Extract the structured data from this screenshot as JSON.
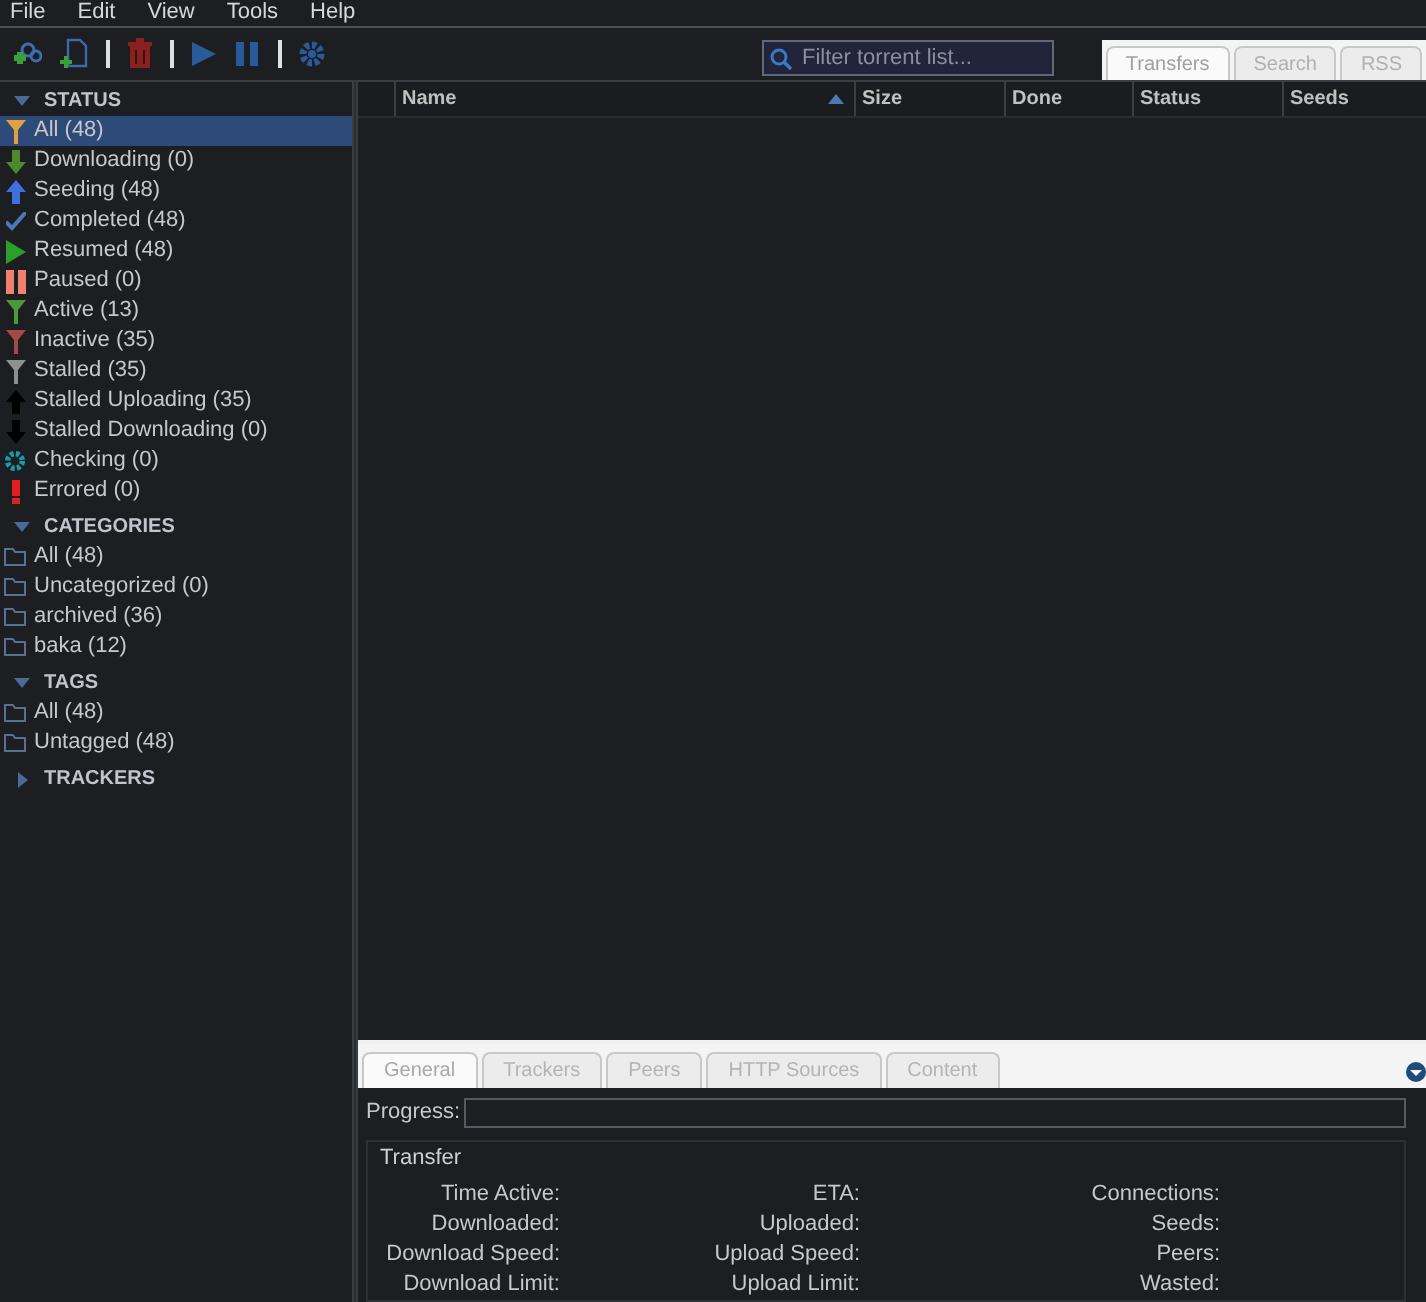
{
  "menu": [
    "File",
    "Edit",
    "View",
    "Tools",
    "Help"
  ],
  "search": {
    "placeholder": "Filter torrent list..."
  },
  "view_tabs": [
    {
      "label": "Transfers",
      "selected": true
    },
    {
      "label": "Search",
      "selected": false
    },
    {
      "label": "RSS",
      "selected": false
    }
  ],
  "sidebar": {
    "sections": [
      {
        "title": "STATUS",
        "expanded": true,
        "items": [
          {
            "label": "All (48)",
            "selected": true
          },
          {
            "label": "Downloading (0)",
            "selected": false
          },
          {
            "label": "Seeding (48)",
            "selected": false
          },
          {
            "label": "Completed (48)",
            "selected": false
          },
          {
            "label": "Resumed (48)",
            "selected": false
          },
          {
            "label": "Paused (0)",
            "selected": false
          },
          {
            "label": "Active (13)",
            "selected": false
          },
          {
            "label": "Inactive (35)",
            "selected": false
          },
          {
            "label": "Stalled (35)",
            "selected": false
          },
          {
            "label": "Stalled Uploading (35)",
            "selected": false
          },
          {
            "label": "Stalled Downloading (0)",
            "selected": false
          },
          {
            "label": "Checking (0)",
            "selected": false
          },
          {
            "label": "Errored (0)",
            "selected": false
          }
        ]
      },
      {
        "title": "CATEGORIES",
        "expanded": true,
        "items": [
          {
            "label": "All (48)",
            "selected": false
          },
          {
            "label": "Uncategorized (0)",
            "selected": false
          },
          {
            "label": "archived (36)",
            "selected": false
          },
          {
            "label": "baka (12)",
            "selected": false
          }
        ]
      },
      {
        "title": "TAGS",
        "expanded": true,
        "items": [
          {
            "label": "All (48)",
            "selected": false
          },
          {
            "label": "Untagged (48)",
            "selected": false
          }
        ]
      },
      {
        "title": "TRACKERS",
        "expanded": false
      }
    ]
  },
  "table": {
    "columns": [
      {
        "label": "Name",
        "sorted": true
      },
      {
        "label": "Size",
        "sorted": false
      },
      {
        "label": "Done",
        "sorted": false
      },
      {
        "label": "Status",
        "sorted": false
      },
      {
        "label": "Seeds",
        "sorted": false
      }
    ]
  },
  "detail_tabs": [
    {
      "label": "General",
      "selected": true
    },
    {
      "label": "Trackers",
      "selected": false
    },
    {
      "label": "Peers",
      "selected": false
    },
    {
      "label": "HTTP Sources",
      "selected": false
    },
    {
      "label": "Content",
      "selected": false
    }
  ],
  "progress_label": "Progress:",
  "progress": {
    "level": 0
  },
  "transfer": {
    "title": "Transfer",
    "rows": [
      [
        "Time Active:",
        "ETA:",
        "Connections:"
      ],
      [
        "Downloaded:",
        "Uploaded:",
        "Seeds:"
      ],
      [
        "Download Speed:",
        "Upload Speed:",
        "Peers:"
      ],
      [
        "Download Limit:",
        "Upload Limit:",
        "Wasted:"
      ]
    ]
  }
}
